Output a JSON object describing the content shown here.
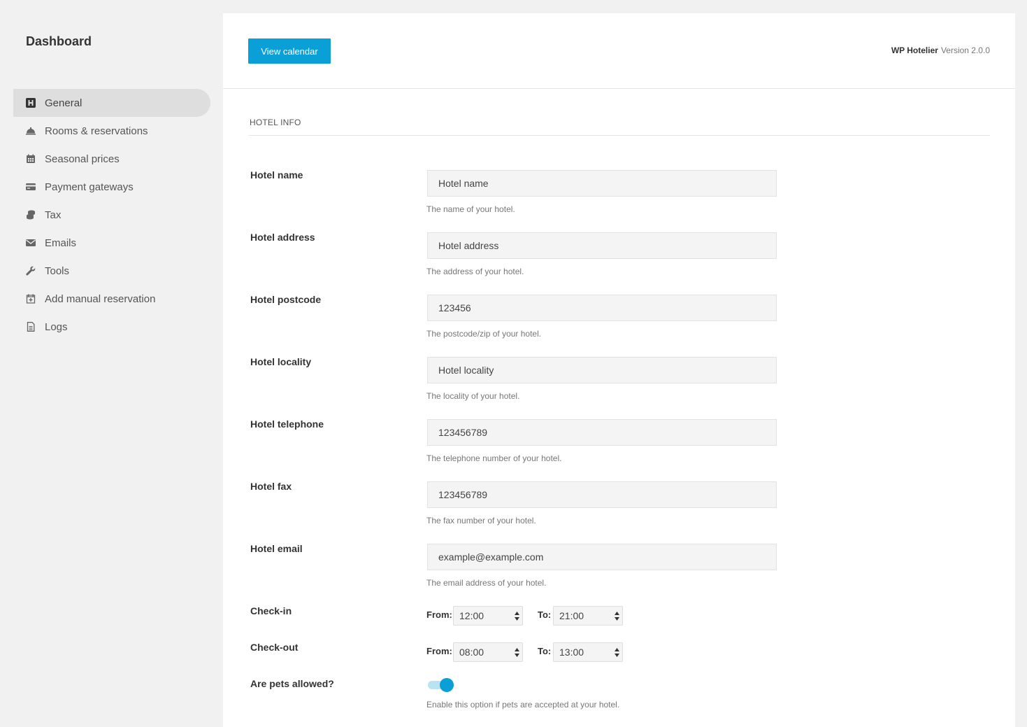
{
  "sidebar": {
    "title": "Dashboard",
    "items": [
      {
        "label": "General",
        "icon": "hotel-icon",
        "active": true
      },
      {
        "label": "Rooms & reservations",
        "icon": "room-service-bell-icon"
      },
      {
        "label": "Seasonal prices",
        "icon": "calendar-icon"
      },
      {
        "label": "Payment gateways",
        "icon": "credit-card-icon"
      },
      {
        "label": "Tax",
        "icon": "coins-icon"
      },
      {
        "label": "Emails",
        "icon": "envelope-icon"
      },
      {
        "label": "Tools",
        "icon": "wrench-icon"
      },
      {
        "label": "Add manual reservation",
        "icon": "calendar-plus-icon"
      },
      {
        "label": "Logs",
        "icon": "document-icon"
      }
    ]
  },
  "header": {
    "view_calendar": "View calendar",
    "brand": "WP Hotelier",
    "version": "Version 2.0.0"
  },
  "section": {
    "title": "HOTEL INFO"
  },
  "fields": {
    "name": {
      "label": "Hotel name",
      "value": "Hotel name",
      "help": "The name of your hotel."
    },
    "address": {
      "label": "Hotel address",
      "value": "Hotel address",
      "help": "The address of your hotel."
    },
    "postcode": {
      "label": "Hotel postcode",
      "value": "123456",
      "help": "The postcode/zip of your hotel."
    },
    "locality": {
      "label": "Hotel locality",
      "value": "Hotel locality",
      "help": "The locality of your hotel."
    },
    "telephone": {
      "label": "Hotel telephone",
      "value": "123456789",
      "help": "The telephone number of your hotel."
    },
    "fax": {
      "label": "Hotel fax",
      "value": "123456789",
      "help": "The fax number of your hotel."
    },
    "email": {
      "label": "Hotel email",
      "value": "example@example.com",
      "help": "The email address of your hotel."
    }
  },
  "checkin": {
    "label": "Check-in",
    "from_label": "From:",
    "from": "12:00",
    "to_label": "To:",
    "to": "21:00"
  },
  "checkout": {
    "label": "Check-out",
    "from_label": "From:",
    "from": "08:00",
    "to_label": "To:",
    "to": "13:00"
  },
  "pets": {
    "label": "Are pets allowed?",
    "enabled": true,
    "help": "Enable this option if pets are accepted at your hotel."
  },
  "colors": {
    "accent": "#0a9fd6",
    "sidebar_bg": "#f1f1f1",
    "active_item_bg": "#dedede"
  }
}
